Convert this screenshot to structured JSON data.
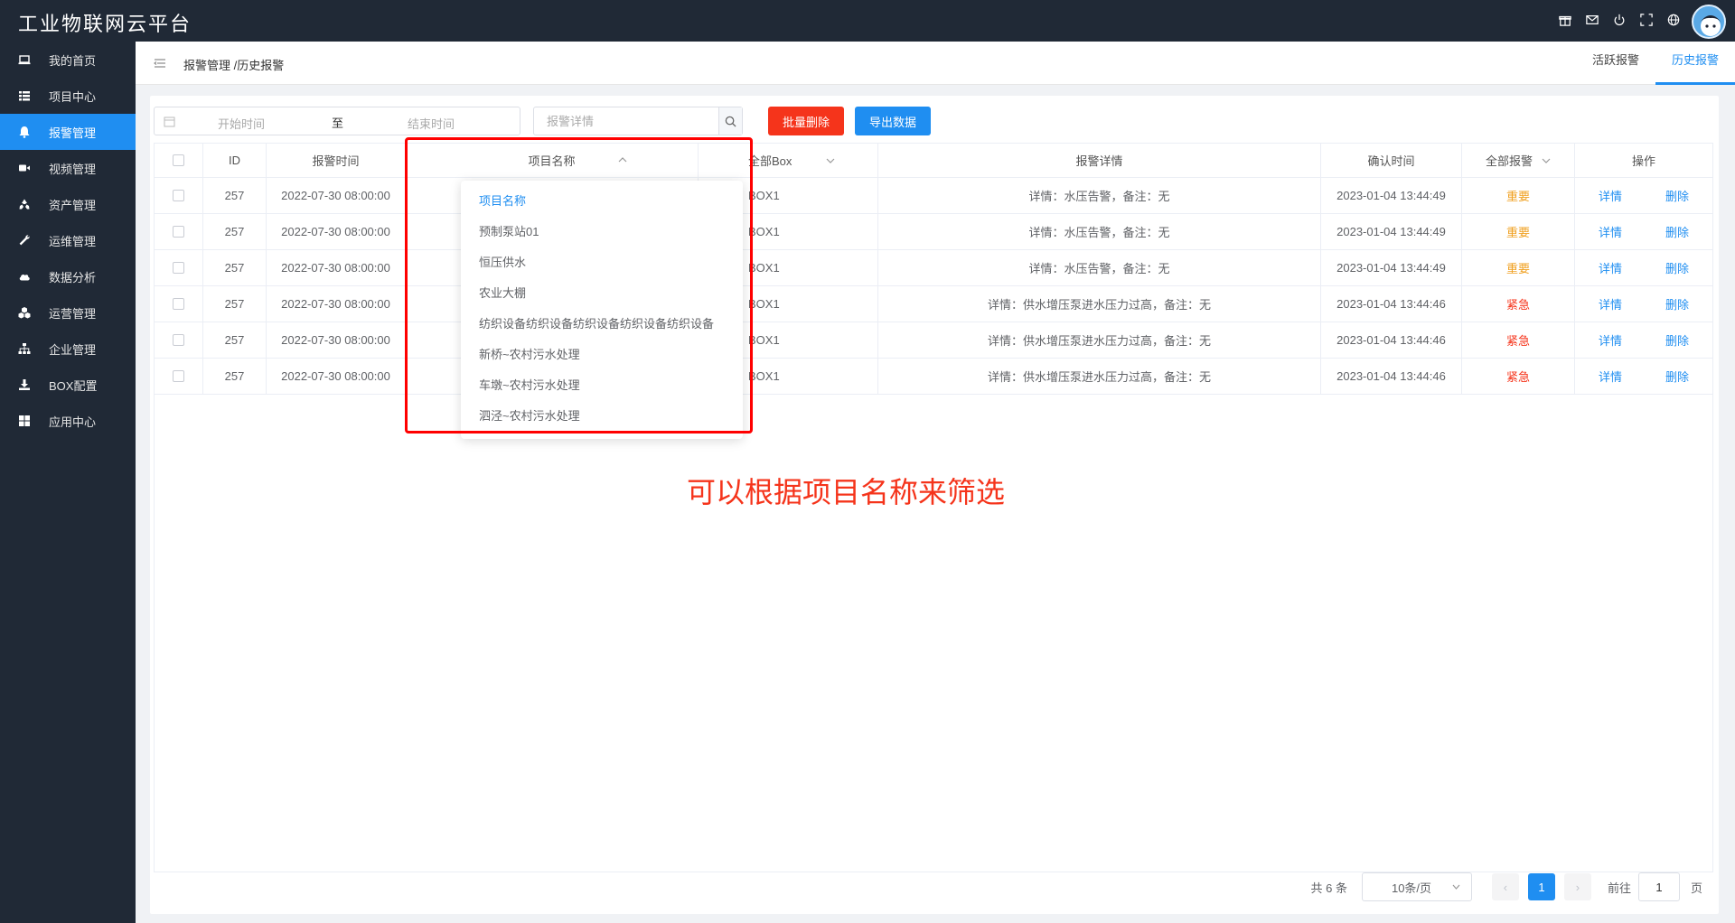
{
  "app": {
    "title": "工业物联网云平台"
  },
  "top_icons": [
    "gift-icon",
    "mail-icon",
    "power-icon",
    "fullscreen-icon",
    "globe-icon"
  ],
  "sidebar": {
    "items": [
      {
        "label": "我的首页",
        "icon": "laptop-icon",
        "active": false
      },
      {
        "label": "项目中心",
        "icon": "list-icon",
        "active": false
      },
      {
        "label": "报警管理",
        "icon": "bell-icon",
        "active": true
      },
      {
        "label": "视频管理",
        "icon": "video-icon",
        "active": false
      },
      {
        "label": "资产管理",
        "icon": "recycle-icon",
        "active": false
      },
      {
        "label": "运维管理",
        "icon": "wrench-icon",
        "active": false
      },
      {
        "label": "数据分析",
        "icon": "cloud-icon",
        "active": false
      },
      {
        "label": "运营管理",
        "icon": "cubes-icon",
        "active": false
      },
      {
        "label": "企业管理",
        "icon": "sitemap-icon",
        "active": false
      },
      {
        "label": "BOX配置",
        "icon": "download-icon",
        "active": false
      },
      {
        "label": "应用中心",
        "icon": "grid-icon",
        "active": false
      }
    ]
  },
  "header": {
    "breadcrumb": "报警管理 /历史报警",
    "tabs": [
      {
        "label": "活跃报警",
        "active": false
      },
      {
        "label": "历史报警",
        "active": true
      }
    ]
  },
  "filters": {
    "start_placeholder": "开始时间",
    "range_sep": "至",
    "end_placeholder": "结束时间",
    "search_placeholder": "报警详情",
    "batch_delete": "批量删除",
    "export": "导出数据"
  },
  "table": {
    "headers": {
      "id": "ID",
      "time": "报警时间",
      "project": "项目名称",
      "box": "全部Box",
      "detail": "报警详情",
      "confirm": "确认时间",
      "level": "全部报警",
      "ops": "操作"
    },
    "actions": {
      "detail": "详情",
      "delete": "删除"
    },
    "rows": [
      {
        "id": "257",
        "time": "2022-07-30 08:00:00",
        "box": "BOX1",
        "detail": "详情：水压告警，备注：无",
        "confirm": "2023-01-04 13:44:49",
        "level": "重要",
        "level_type": "important"
      },
      {
        "id": "257",
        "time": "2022-07-30 08:00:00",
        "box": "BOX1",
        "detail": "详情：水压告警，备注：无",
        "confirm": "2023-01-04 13:44:49",
        "level": "重要",
        "level_type": "important"
      },
      {
        "id": "257",
        "time": "2022-07-30 08:00:00",
        "box": "BOX1",
        "detail": "详情：水压告警，备注：无",
        "confirm": "2023-01-04 13:44:49",
        "level": "重要",
        "level_type": "important"
      },
      {
        "id": "257",
        "time": "2022-07-30 08:00:00",
        "box": "BOX1",
        "detail": "详情：供水增压泵进水压力过高，备注：无",
        "confirm": "2023-01-04 13:44:46",
        "level": "紧急",
        "level_type": "urgent"
      },
      {
        "id": "257",
        "time": "2022-07-30 08:00:00",
        "box": "BOX1",
        "detail": "详情：供水增压泵进水压力过高，备注：无",
        "confirm": "2023-01-04 13:44:46",
        "level": "紧急",
        "level_type": "urgent"
      },
      {
        "id": "257",
        "time": "2022-07-30 08:00:00",
        "box": "BOX1",
        "detail": "详情：供水增压泵进水压力过高，备注：无",
        "confirm": "2023-01-04 13:44:46",
        "level": "紧急",
        "level_type": "urgent"
      }
    ]
  },
  "dropdown": {
    "options": [
      {
        "label": "项目名称",
        "selected": true
      },
      {
        "label": "预制泵站01",
        "selected": false
      },
      {
        "label": "恒压供水",
        "selected": false
      },
      {
        "label": "农业大棚",
        "selected": false
      },
      {
        "label": "纺织设备纺织设备纺织设备纺织设备纺织设备",
        "selected": false
      },
      {
        "label": "新桥~农村污水处理",
        "selected": false
      },
      {
        "label": "车墩~农村污水处理",
        "selected": false
      },
      {
        "label": "泗泾~农村污水处理",
        "selected": false
      }
    ]
  },
  "annotation": "可以根据项目名称来筛选",
  "pagination": {
    "total": "共 6 条",
    "page_size": "10条/页",
    "current_page": "1",
    "goto_label": "前往",
    "goto_value": "1",
    "page_suffix": "页"
  },
  "colors": {
    "accent": "#1f8ef1",
    "danger": "#f5341b",
    "warning": "#f0a020",
    "dark": "#202936"
  }
}
